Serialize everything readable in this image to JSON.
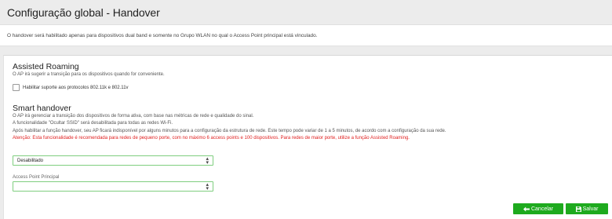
{
  "page": {
    "title": "Configuração global - Handover",
    "notice": "O handover será habilitado apenas para dispositivos dual band e somente no Grupo WLAN no qual o Access Point principal está vinculado."
  },
  "assisted_roaming": {
    "title": "Assisted Roaming",
    "description": "O AP irá sugerir a transição para os dispositivos quando for conveniente.",
    "checkbox_label": "Habilitar suporte aos protocolos 802.11k e 802.11v",
    "checked": false
  },
  "smart_handover": {
    "title": "Smart handover",
    "lines": [
      "O AP irá gerenciar a transição dos dispositivos de forma ativa, com base nas métricas de rede e qualidade do sinal.",
      "A funcionalidade \"Ocultar SSID\" será desabilitada para todas as redes Wi-Fi.",
      "Após habilitar a função handover, seu AP ficará indisponível por alguns minutos para a configuração da estrutura de rede. Este tempo pode variar de 1 a 5 minutos, de acordo com a configuração da sua rede."
    ],
    "warning": "Atenção: Esta funcionalidade é recomendada para redes de pequeno porte, com no máximo 6 access points e 100 dispositivos. Para redes de maior porte, utilize a função Assisted Roaming.",
    "mode_select": {
      "value": "Desabilitado"
    },
    "ap_select": {
      "label": "Access Point Principal",
      "value": ""
    }
  },
  "actions": {
    "cancel_label": "Cancelar",
    "save_label": "Salvar",
    "button_color": "#1eaa1e"
  },
  "icons": {
    "cancel": "arrow-left-icon",
    "save": "floppy-disk-icon",
    "select": "sort-arrows-icon"
  }
}
